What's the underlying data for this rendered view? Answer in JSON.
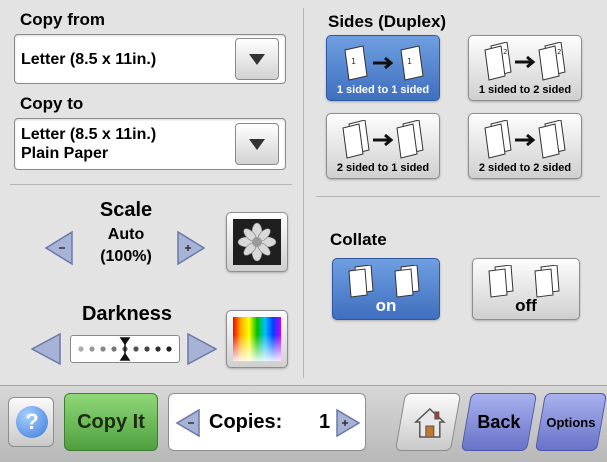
{
  "copy_from": {
    "label": "Copy from",
    "value": "Letter (8.5 x 11in.)"
  },
  "copy_to": {
    "label": "Copy to",
    "value_line1": "Letter (8.5 x 11in.)",
    "value_line2": "Plain Paper"
  },
  "scale": {
    "title": "Scale",
    "mode": "Auto",
    "value": "(100%)"
  },
  "darkness": {
    "title": "Darkness",
    "level_fraction": 0.5
  },
  "sides": {
    "title": "Sides (Duplex)",
    "options": [
      {
        "label": "1 sided to 1 sided",
        "selected": true
      },
      {
        "label": "1 sided to 2 sided",
        "selected": false
      },
      {
        "label": "2 sided to 1 sided",
        "selected": false
      },
      {
        "label": "2 sided to 2 sided",
        "selected": false
      }
    ]
  },
  "collate": {
    "title": "Collate",
    "options": [
      {
        "label": "on",
        "selected": true
      },
      {
        "label": "off",
        "selected": false
      }
    ]
  },
  "footer": {
    "help_symbol": "?",
    "copy_it": "Copy It",
    "copies_label": "Copies:",
    "copies_value": "1",
    "back": "Back",
    "options": "Options"
  },
  "colors": {
    "selected_blue": "#4a7fd0",
    "copy_it_green": "#6bbf55",
    "back_purple": "#7a84d8"
  },
  "icons": [
    "chevron-down-icon",
    "arrow-left-icon",
    "arrow-right-icon",
    "flower-icon",
    "color-spectrum-icon",
    "page-icon",
    "home-icon",
    "help-icon"
  ]
}
